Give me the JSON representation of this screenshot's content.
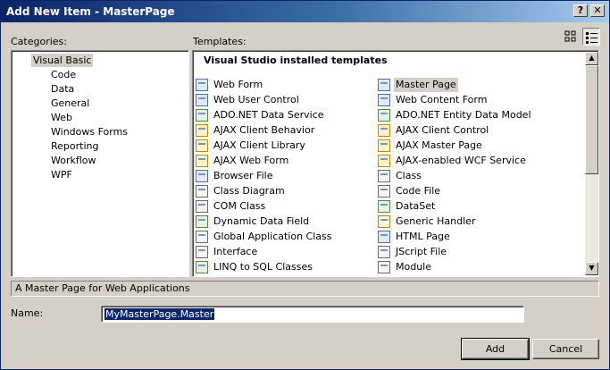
{
  "window": {
    "title": "Add New Item - MasterPage",
    "help_glyph": "?",
    "close_glyph": "✕"
  },
  "labels": {
    "categories": "Categories:",
    "templates": "Templates:",
    "name": "Name:"
  },
  "categories": {
    "selected": "Visual Basic",
    "items": [
      "Visual Basic",
      "Code",
      "Data",
      "General",
      "Web",
      "Windows Forms",
      "Reporting",
      "Workflow",
      "WPF"
    ]
  },
  "templates": {
    "section_header": "Visual Studio installed templates",
    "selected": "Master Page",
    "left": [
      "Web Form",
      "Web User Control",
      "ADO.NET Data Service",
      "AJAX Client Behavior",
      "AJAX Client Library",
      "AJAX Web Form",
      "Browser File",
      "Class Diagram",
      "COM Class",
      "Dynamic Data Field",
      "Global Application Class",
      "Interface",
      "LINQ to SQL Classes"
    ],
    "right": [
      "Master Page",
      "Web Content Form",
      "ADO.NET Entity Data Model",
      "AJAX Client Control",
      "AJAX Master Page",
      "AJAX-enabled WCF Service",
      "Class",
      "Code File",
      "DataSet",
      "Generic Handler",
      "HTML Page",
      "JScript File",
      "Module"
    ]
  },
  "description": "A Master Page for Web Applications",
  "name_field": {
    "value": "MyMasterPage.Master"
  },
  "buttons": {
    "add": "Add",
    "cancel": "Cancel"
  },
  "view_modes": {
    "active": "small-icons"
  }
}
